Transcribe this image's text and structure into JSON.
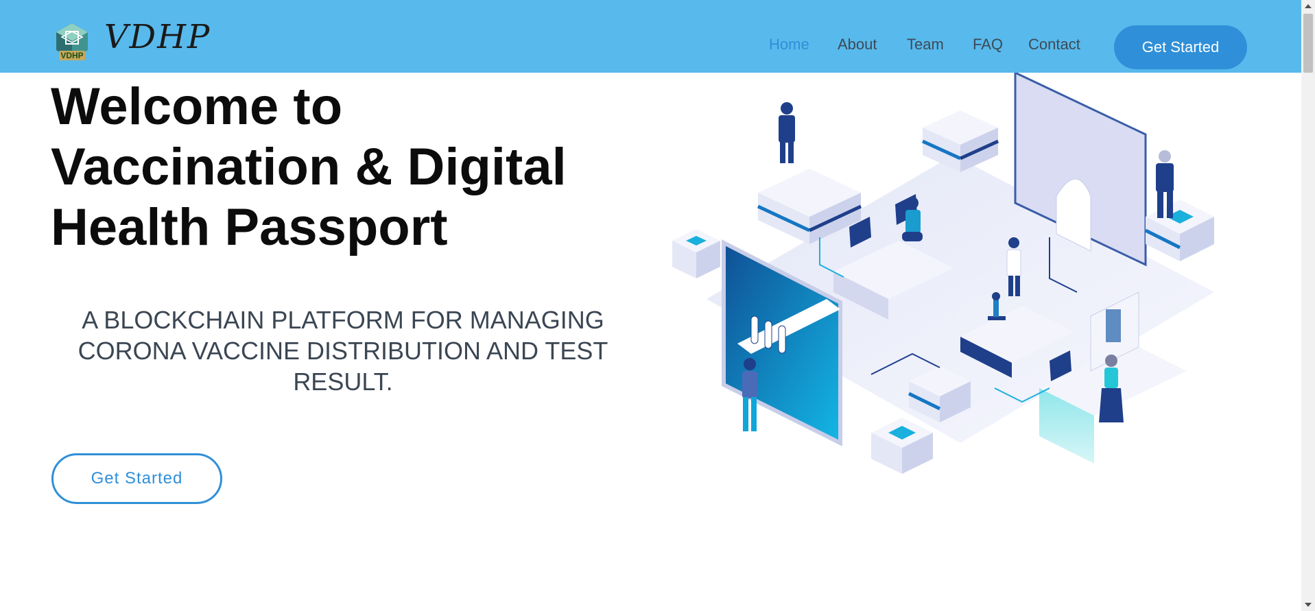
{
  "brand": {
    "name": "VDHP",
    "logo_badge_text": "VDHP",
    "logo_icon": "hexagon-cube-logo-icon"
  },
  "nav": {
    "items": [
      {
        "label": "Home",
        "active": true
      },
      {
        "label": "About",
        "active": false
      },
      {
        "label": "Team",
        "active": false
      },
      {
        "label": "FAQ",
        "active": false
      },
      {
        "label": "Contact",
        "active": false
      }
    ],
    "cta_label": "Get Started"
  },
  "hero": {
    "title_lines": [
      "Welcome to",
      "Vaccination & Digital",
      "Health Passport"
    ],
    "subtitle": "A BLOCKCHAIN PLATFORM FOR MANAGING CORONA VACCINE DISTRIBUTION AND TEST RESULT.",
    "cta_label": "Get Started",
    "illustration_icon": "isometric-lab-illustration"
  },
  "colors": {
    "navbar_bg": "#58b9ec",
    "accent": "#2f8fd8",
    "nav_text": "#3d4a57",
    "title_text": "#0c0c0c",
    "subtitle_text": "#3b4653"
  }
}
